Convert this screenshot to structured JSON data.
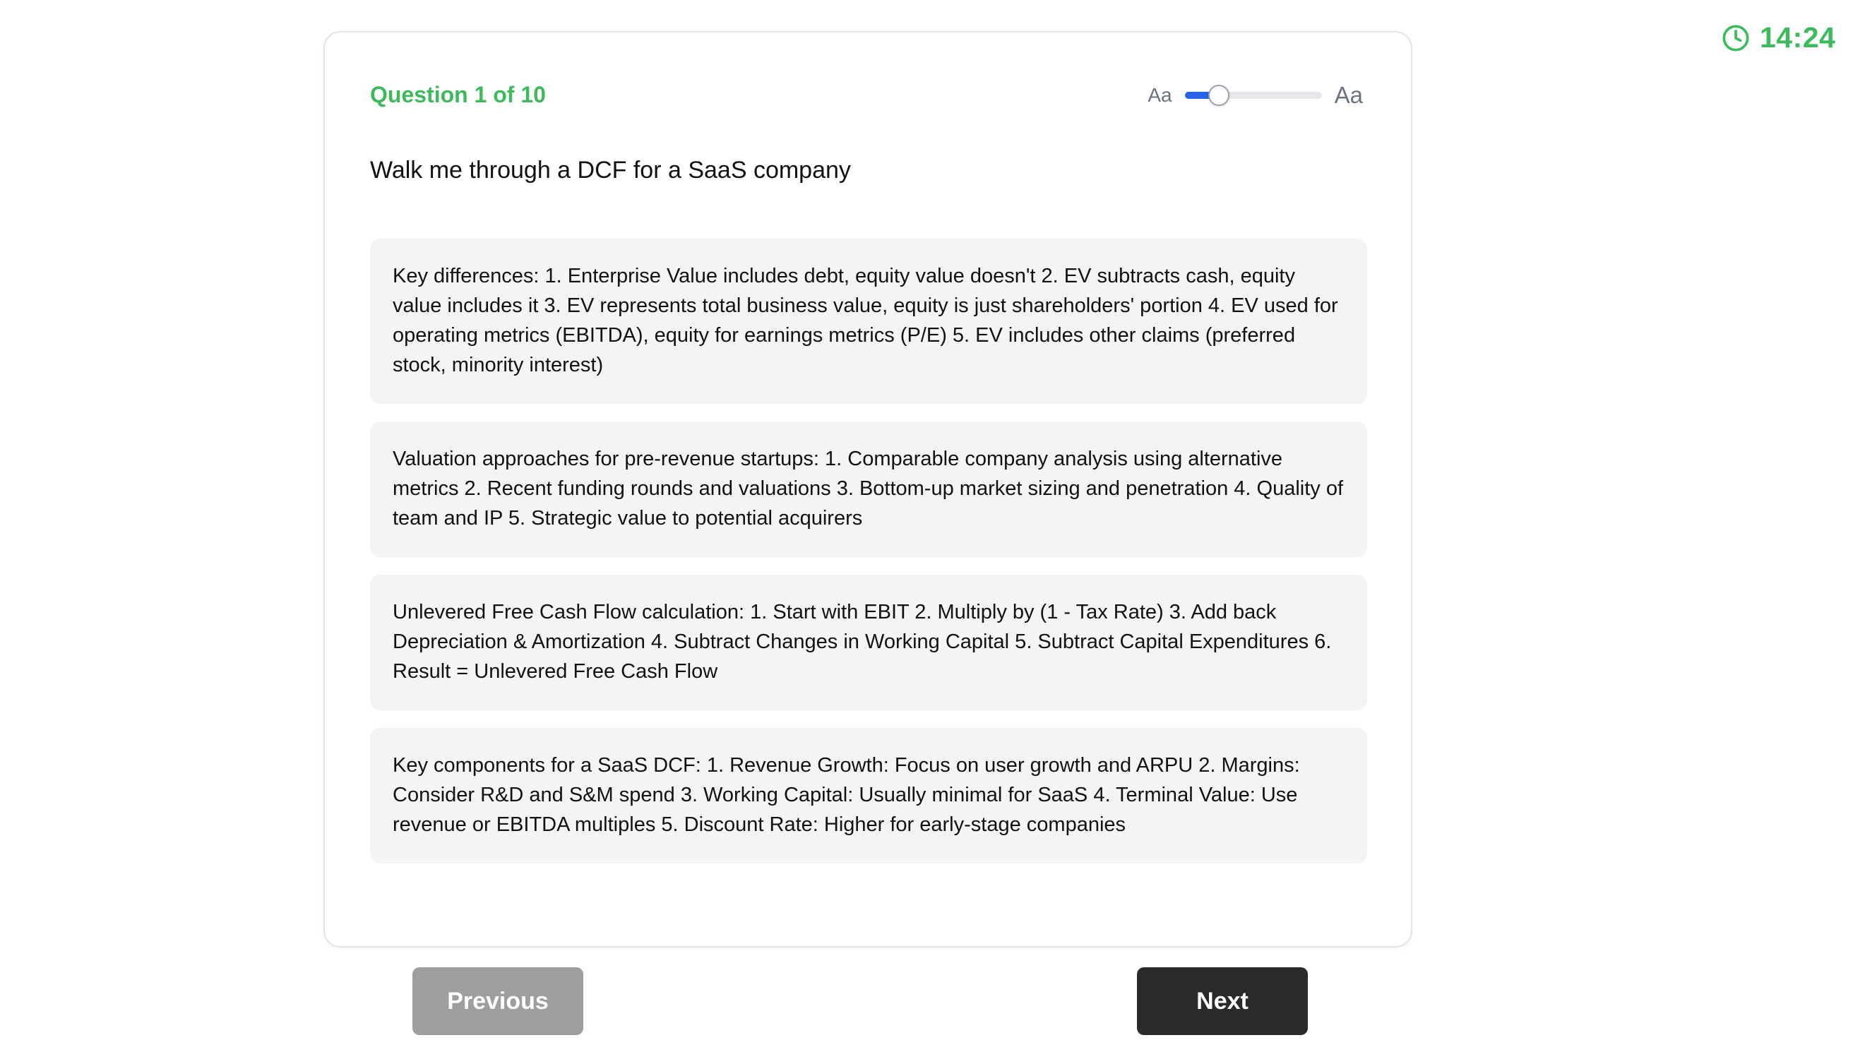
{
  "timer": {
    "icon": "clock-icon",
    "value": "14:24",
    "color": "#3dbb5c"
  },
  "quiz": {
    "counter": "Question 1 of 10",
    "question": "Walk me through a DCF for a SaaS company",
    "font_control": {
      "small_label": "Aa",
      "large_label": "Aa",
      "level": 0.25,
      "accent": "#2563eb"
    },
    "answers": [
      "Key differences: 1. Enterprise Value includes debt, equity value doesn't 2. EV subtracts cash, equity value includes it 3. EV represents total business value, equity is just shareholders' portion 4. EV used for operating metrics (EBITDA), equity for earnings metrics (P/E) 5. EV includes other claims (preferred stock, minority interest)",
      "Valuation approaches for pre-revenue startups: 1. Comparable company analysis using alternative metrics 2. Recent funding rounds and valuations 3. Bottom-up market sizing and penetration 4. Quality of team and IP 5. Strategic value to potential acquirers",
      "Unlevered Free Cash Flow calculation: 1. Start with EBIT 2. Multiply by (1 - Tax Rate) 3. Add back Depreciation & Amortization 4. Subtract Changes in Working Capital 5. Subtract Capital Expenditures 6. Result = Unlevered Free Cash Flow",
      "Key components for a SaaS DCF: 1. Revenue Growth: Focus on user growth and ARPU 2. Margins: Consider R&D and S&M spend 3. Working Capital: Usually minimal for SaaS 4. Terminal Value: Use revenue or EBITDA multiples 5. Discount Rate: Higher for early-stage companies"
    ]
  },
  "nav": {
    "previous_label": "Previous",
    "next_label": "Next"
  }
}
